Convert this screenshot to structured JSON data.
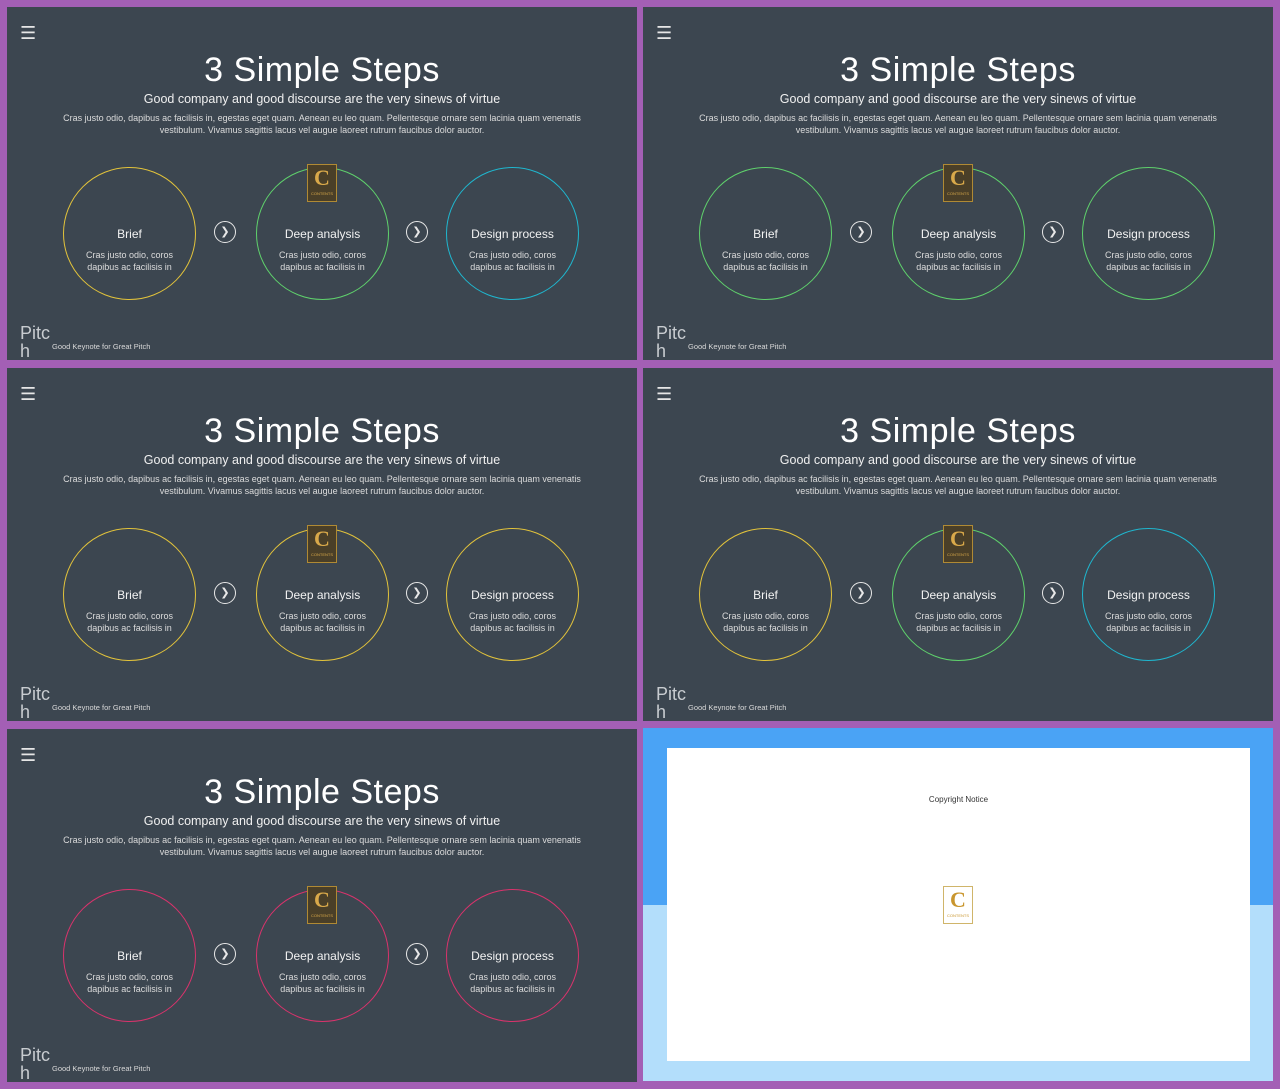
{
  "slide": {
    "menu_icon": "☰",
    "title": "3 Simple Steps",
    "subtitle": "Good company and good discourse are the very sinews of virtue",
    "body": "Cras justo odio, dapibus ac facilisis in, egestas eget quam. Aenean eu leo quam. Pellentesque ornare sem lacinia quam venenatis vestibulum. Vivamus sagittis lacus vel augue laoreet rutrum faucibus dolor auctor.",
    "steps": [
      {
        "title": "Brief",
        "desc": "Cras justo odio, coros dapibus ac facilisis in"
      },
      {
        "title": "Deep analysis",
        "desc": "Cras justo odio, coros dapibus ac facilisis in"
      },
      {
        "title": "Design process",
        "desc": "Cras justo odio, coros dapibus ac facilisis in"
      }
    ],
    "arrow_icon": "❯",
    "brand": "Pitch",
    "footer": "Good Keynote for Great Pitch",
    "badge_letter": "C",
    "badge_text": "CONTENTS"
  },
  "colors": {
    "yellow": "#e2c33b",
    "green": "#5fd16c",
    "cyan": "#1fb7cf",
    "magenta": "#d9336c"
  },
  "slides": [
    {
      "circle_colors": [
        "#e2c33b",
        "#5fd16c",
        "#1fb7cf"
      ]
    },
    {
      "circle_colors": [
        "#5fd16c",
        "#5fd16c",
        "#5fd16c"
      ]
    },
    {
      "circle_colors": [
        "#e2c33b",
        "#e2c33b",
        "#e2c33b"
      ]
    },
    {
      "circle_colors": [
        "#e2c33b",
        "#5fd16c",
        "#1fb7cf"
      ]
    },
    {
      "circle_colors": [
        "#d9336c",
        "#d9336c",
        "#d9336c"
      ]
    }
  ],
  "copyright": {
    "title": "Copyright Notice",
    "logo_letter": "C",
    "logo_text": "CONTENTS"
  }
}
